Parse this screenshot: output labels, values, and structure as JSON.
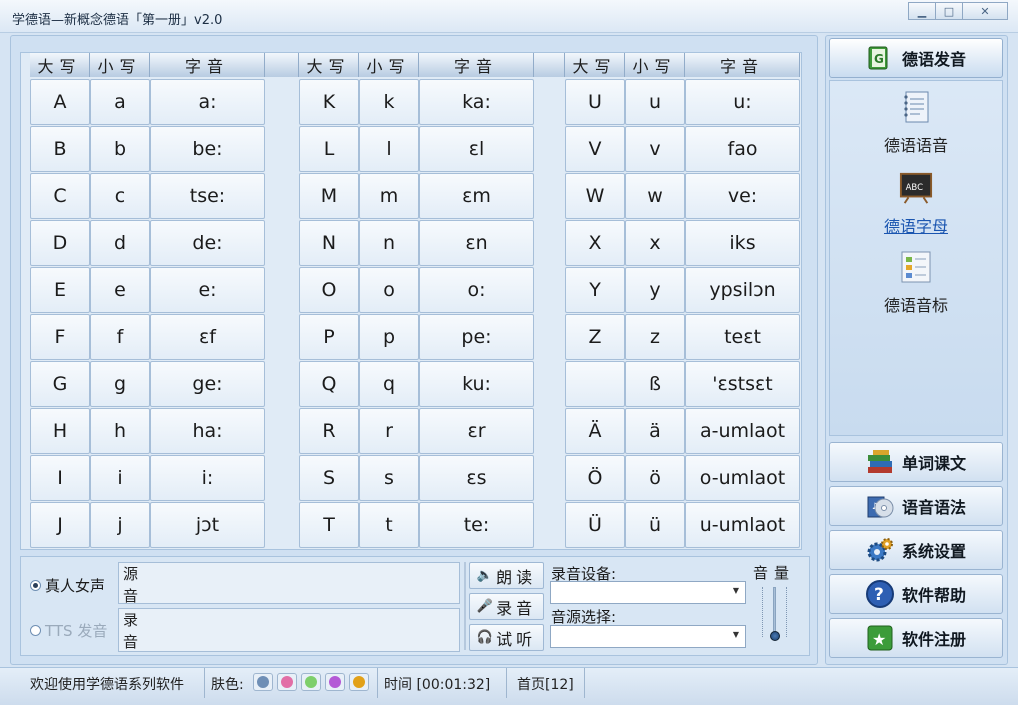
{
  "window": {
    "title": "学德语—新概念德语「第一册」v2.0",
    "min_glyph": "▁",
    "max_glyph": "□",
    "close_glyph": "✕"
  },
  "table": {
    "headers": [
      "大写",
      "小写",
      "字音"
    ],
    "groups": [
      [
        [
          "A",
          "a",
          "a:"
        ],
        [
          "B",
          "b",
          "be:"
        ],
        [
          "C",
          "c",
          "tse:"
        ],
        [
          "D",
          "d",
          "de:"
        ],
        [
          "E",
          "e",
          "e:"
        ],
        [
          "F",
          "f",
          "ɛf"
        ],
        [
          "G",
          "g",
          "ge:"
        ],
        [
          "H",
          "h",
          "ha:"
        ],
        [
          "I",
          "i",
          "i:"
        ],
        [
          "J",
          "j",
          "jɔt"
        ]
      ],
      [
        [
          "K",
          "k",
          "ka:"
        ],
        [
          "L",
          "l",
          "ɛl"
        ],
        [
          "M",
          "m",
          "ɛm"
        ],
        [
          "N",
          "n",
          "ɛn"
        ],
        [
          "O",
          "o",
          "o:"
        ],
        [
          "P",
          "p",
          "pe:"
        ],
        [
          "Q",
          "q",
          "ku:"
        ],
        [
          "R",
          "r",
          "ɛr"
        ],
        [
          "S",
          "s",
          "ɛs"
        ],
        [
          "T",
          "t",
          "te:"
        ]
      ],
      [
        [
          "U",
          "u",
          "u:"
        ],
        [
          "V",
          "v",
          "fao"
        ],
        [
          "W",
          "w",
          "ve:"
        ],
        [
          "X",
          "x",
          "iks"
        ],
        [
          "Y",
          "y",
          "ypsilɔn"
        ],
        [
          "Z",
          "z",
          "teɛt"
        ],
        [
          "",
          "ß",
          "'ɛstsɛt"
        ],
        [
          "Ä",
          "ä",
          "a-umlaot"
        ],
        [
          "Ö",
          "ö",
          "o-umlaot"
        ],
        [
          "Ü",
          "ü",
          "u-umlaot"
        ]
      ]
    ]
  },
  "controls": {
    "voice_real": "真人女声",
    "voice_tts": "TTS 发音",
    "source_label": "源音",
    "record_label": "录音",
    "btn_read": "朗读",
    "btn_record": "录音",
    "btn_listen": "试听",
    "record_device_label": "录音设备:",
    "source_select_label": "音源选择:",
    "record_device_value": "",
    "source_select_value": "",
    "volume_label": "音量",
    "volume_level": 0.05
  },
  "sidebar": {
    "top_button": "德语发音",
    "nav": [
      {
        "label": "德语语音",
        "icon": "notebook-icon",
        "active": false
      },
      {
        "label": "德语字母",
        "icon": "chalkboard-abc-icon",
        "active": true
      },
      {
        "label": "德语音标",
        "icon": "checklist-icon",
        "active": false
      }
    ],
    "buttons": [
      {
        "label": "单词课文",
        "icon": "books-icon"
      },
      {
        "label": "语音语法",
        "icon": "audio-cd-icon"
      },
      {
        "label": "系统设置",
        "icon": "gears-icon"
      },
      {
        "label": "软件帮助",
        "icon": "help-icon"
      },
      {
        "label": "软件注册",
        "icon": "register-star-icon"
      }
    ]
  },
  "status": {
    "welcome": "欢迎使用学德语系列软件",
    "skin_label": "肤色:",
    "skin_colors": [
      "#6f8fb6",
      "#e26ea6",
      "#7ecf6b",
      "#b45ad6",
      "#e2a118"
    ],
    "time": "时间 [00:01:32]",
    "page": "首页[12]"
  },
  "colors": {
    "accent": "#1a55b0",
    "panel": "#cfe0f2"
  }
}
